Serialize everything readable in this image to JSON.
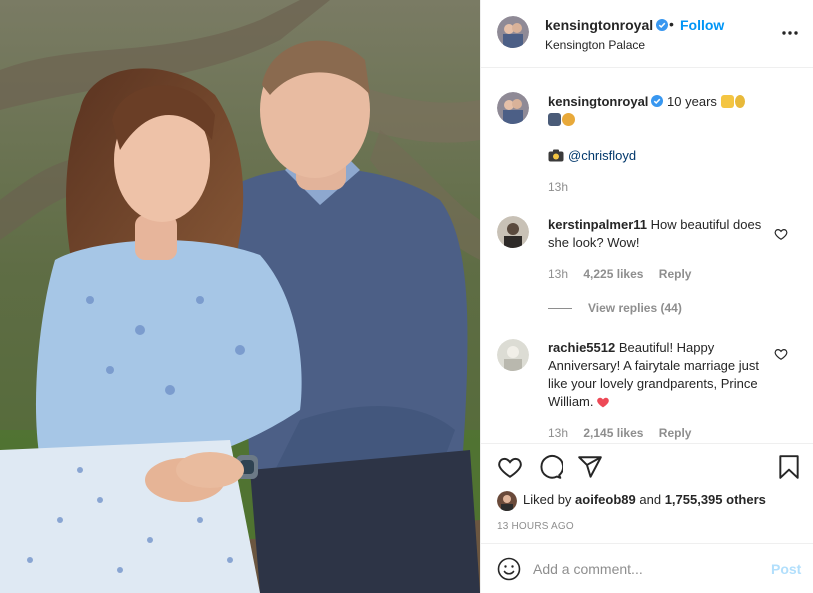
{
  "header": {
    "username": "kensingtonroyal",
    "follow_dot": "•",
    "follow_label": "Follow",
    "location": "Kensington Palace",
    "more_icon": "more-icon"
  },
  "caption": {
    "username": "kensingtonroyal",
    "text": "10 years",
    "credit_handle": "@chrisfloyd",
    "time": "13h"
  },
  "comments": [
    {
      "username": "kerstinpalmer11",
      "text": "How beautiful does she look? Wow!",
      "time": "13h",
      "likes": "4,225 likes",
      "reply_label": "Reply",
      "view_replies": "View replies (44)"
    },
    {
      "username": "rachie5512",
      "text": "Beautiful! Happy Anniversary! A fairytale marriage just like your lovely grandparents, Prince William.",
      "time": "13h",
      "likes": "2,145 likes",
      "reply_label": "Reply"
    }
  ],
  "actions": {
    "icons": [
      "heart-icon",
      "comment-icon",
      "share-icon",
      "bookmark-icon"
    ],
    "liked_by_prefix": "Liked by",
    "liked_by_user": "aoifeob89",
    "liked_by_and": "and",
    "liked_by_count": "1,755,395 others",
    "timestamp": "13 HOURS AGO"
  },
  "add_comment": {
    "placeholder": "Add a comment...",
    "post_label": "Post"
  },
  "colors": {
    "link_blue": "#0095f6",
    "post_disabled": "#b2dffc",
    "muted": "#8e8e8e",
    "heart_red": "#ed4956"
  }
}
